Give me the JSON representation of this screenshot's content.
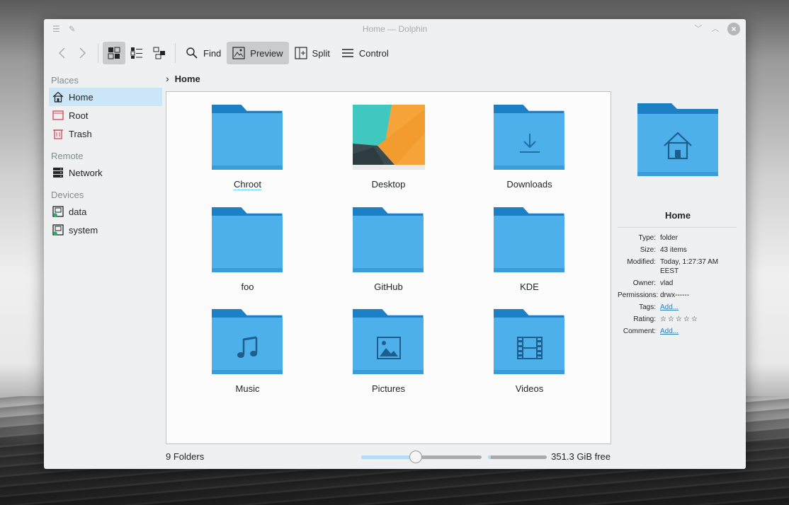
{
  "window": {
    "title": "Home — Dolphin"
  },
  "toolbar": {
    "find_label": "Find",
    "preview_label": "Preview",
    "split_label": "Split",
    "control_label": "Control"
  },
  "sidebar": {
    "groups": [
      {
        "heading": "Places",
        "items": [
          {
            "label": "Home",
            "icon": "home-icon",
            "selected": true
          },
          {
            "label": "Root",
            "icon": "folder-red-icon"
          },
          {
            "label": "Trash",
            "icon": "trash-icon"
          }
        ]
      },
      {
        "heading": "Remote",
        "items": [
          {
            "label": "Network",
            "icon": "network-icon"
          }
        ]
      },
      {
        "heading": "Devices",
        "items": [
          {
            "label": "data",
            "icon": "drive-icon"
          },
          {
            "label": "system",
            "icon": "drive-icon"
          }
        ]
      }
    ]
  },
  "breadcrumb": {
    "current": "Home"
  },
  "files": [
    {
      "name": "Chroot",
      "type": "folder"
    },
    {
      "name": "Desktop",
      "type": "preview"
    },
    {
      "name": "Downloads",
      "type": "folder",
      "emblem": "download-icon"
    },
    {
      "name": "foo",
      "type": "folder"
    },
    {
      "name": "GitHub",
      "type": "folder"
    },
    {
      "name": "KDE",
      "type": "folder"
    },
    {
      "name": "Music",
      "type": "folder",
      "emblem": "music-note-icon"
    },
    {
      "name": "Pictures",
      "type": "folder",
      "emblem": "picture-icon"
    },
    {
      "name": "Videos",
      "type": "folder",
      "emblem": "film-icon"
    }
  ],
  "status": {
    "count": "9 Folders",
    "free_space": "351.3 GiB free",
    "zoom_level": 0.45,
    "disk_used_fraction": 0.05
  },
  "info_panel": {
    "title": "Home",
    "rows": [
      {
        "key": "Type:",
        "value": "folder"
      },
      {
        "key": "Size:",
        "value": "43 items"
      },
      {
        "key": "Modified:",
        "value": "Today, 1:27:37 AM EEST"
      },
      {
        "key": "Owner:",
        "value": "vlad"
      },
      {
        "key": "Permissions:",
        "value": "drwx------"
      },
      {
        "key": "Tags:",
        "value": "Add...",
        "link": true
      },
      {
        "key": "Rating:",
        "value": "☆☆☆☆☆",
        "stars": true
      },
      {
        "key": "Comment:",
        "value": "Add...",
        "link": true
      }
    ]
  },
  "colors": {
    "accent": "#3daee9",
    "folder_front": "#4db0ea",
    "folder_back": "#1d7fc4",
    "selection": "#cde6f7"
  }
}
